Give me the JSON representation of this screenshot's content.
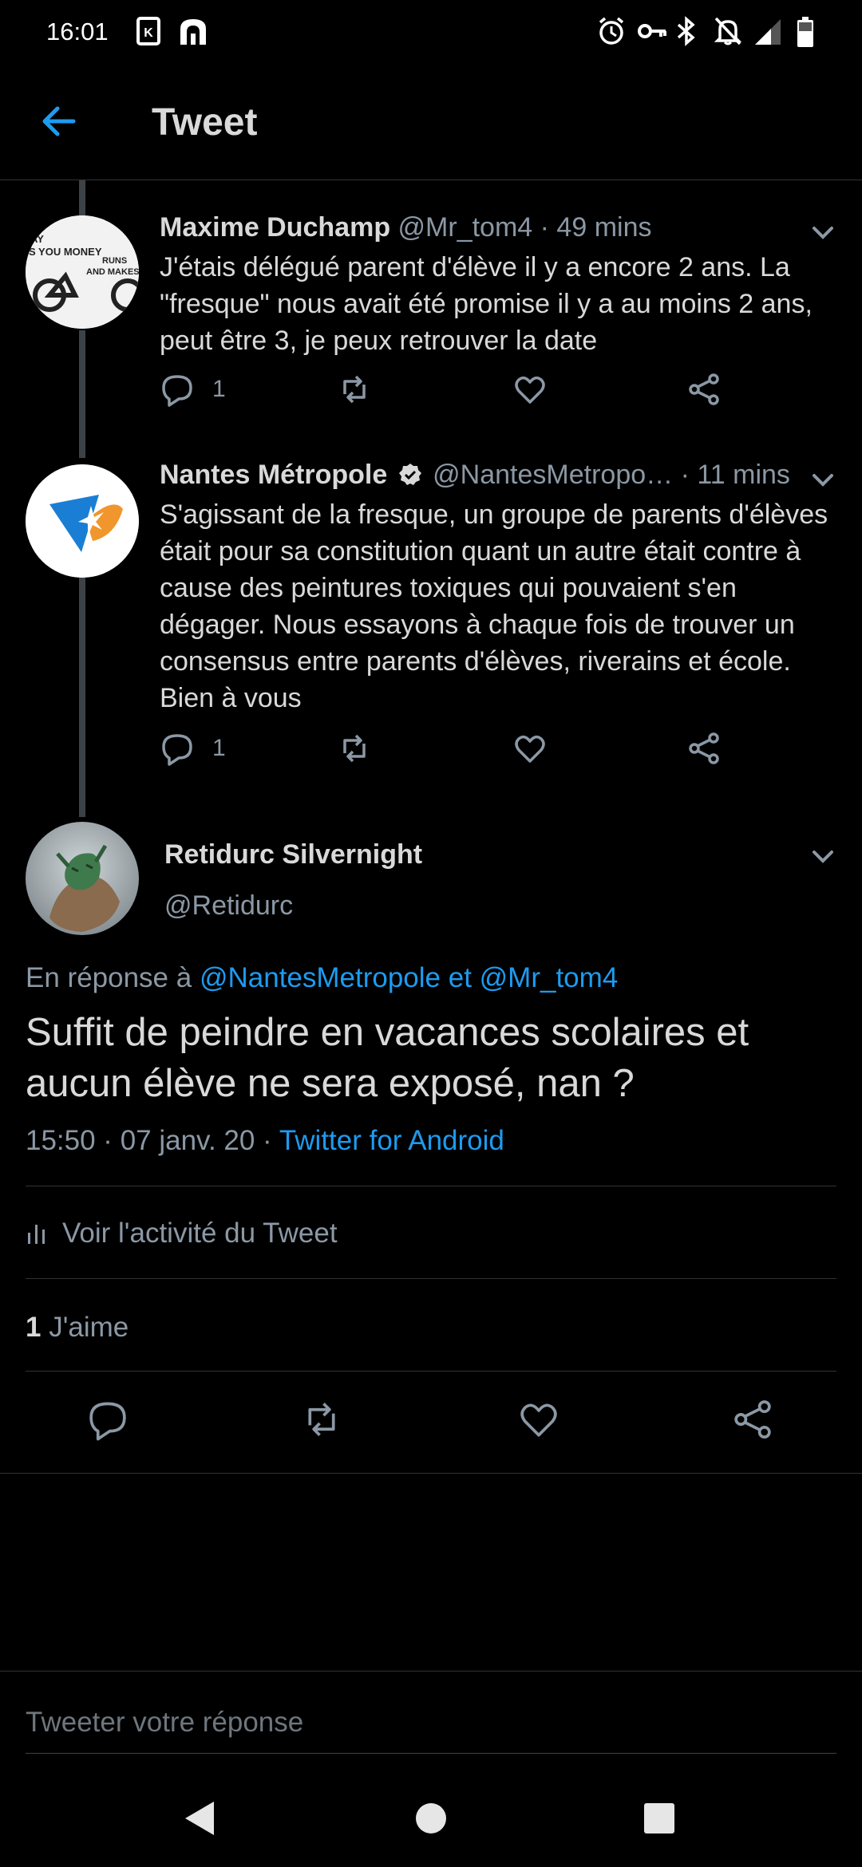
{
  "status_bar": {
    "time": "16:01",
    "left_icons": [
      "keyboard-icon",
      "gateway-icon"
    ],
    "right_icons": [
      "alarm-icon",
      "vpn-key-icon",
      "bluetooth-icon",
      "bell-off-icon",
      "signal-icon",
      "battery-icon"
    ]
  },
  "header": {
    "title": "Tweet",
    "back_icon": "arrow-left-icon"
  },
  "thread": [
    {
      "author": "Maxime Duchamp",
      "handle": "@Mr_tom4",
      "time": "· 49 mins",
      "verified": false,
      "text": "J'étais délégué parent d'élève il y a encore 2 ans. La \"fresque\" nous avait été promise il y a au moins 2 ans, peut être 3, je peux retrouver la date",
      "reply_count": "1"
    },
    {
      "author": "Nantes Métropole",
      "handle": "@NantesMetropo…",
      "time": "· 11 mins",
      "verified": true,
      "text": "S'agissant de la fresque, un groupe de parents d'élèves était pour sa constitution quant un autre était contre à cause des peintures toxiques qui pouvaient s'en dégager. Nous essayons à chaque fois de trouver un consensus entre parents d'élèves, riverains et école. Bien à vous",
      "reply_count": "1"
    }
  ],
  "main_tweet": {
    "author": "Retidurc Silvernight",
    "handle": "@Retidurc",
    "reply_prefix": "En réponse à",
    "reply_targets": "@NantesMetropole et @Mr_tom4",
    "text": "Suffit de peindre en vacances scolaires et aucun élève ne sera exposé, nan ?",
    "timestamp": "15:50 · 07 janv. 20 ·",
    "client": "Twitter for Android",
    "activity_label": "Voir l'activité du Tweet",
    "likes_count": "1",
    "likes_label": "J'aime"
  },
  "reply_box": {
    "placeholder": "Tweeter votre réponse"
  },
  "colors": {
    "accent": "#1d9bf0",
    "background": "#000000",
    "text": "#d9d9d9",
    "muted": "#8b98a5"
  }
}
